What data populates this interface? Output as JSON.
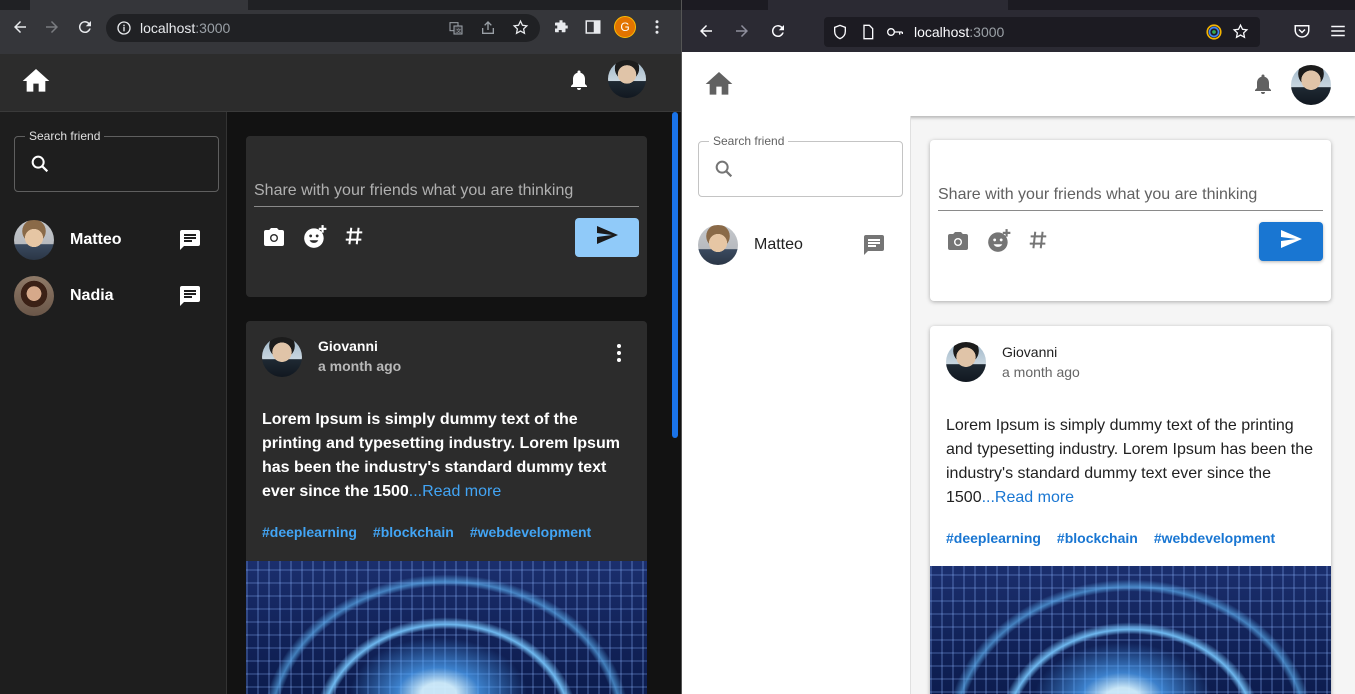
{
  "left_browser": {
    "url_host": "localhost",
    "url_port": ":3000",
    "profile_initial": "G"
  },
  "right_browser": {
    "url_host": "localhost",
    "url_port": ":3000"
  },
  "app": {
    "search_label": "Search friend",
    "friends_left": [
      {
        "name": "Matteo"
      },
      {
        "name": "Nadia"
      }
    ],
    "friends_right": [
      {
        "name": "Matteo"
      }
    ],
    "share_placeholder": "Share with your friends what you are thinking",
    "post": {
      "author": "Giovanni",
      "time": "a month ago",
      "text": "Lorem Ipsum is simply dummy text of the printing and typesetting industry. Lorem Ipsum has been the industry's standard dummy text ever since the 1500",
      "read_more": "...Read more",
      "tags": [
        "#deeplearning",
        "#blockchain",
        "#webdevelopment"
      ]
    }
  },
  "colors": {
    "accent": "#1976d2",
    "send_dark": "#90caf9",
    "dark_surface": "#2c2c2c",
    "dark_bg": "#121212"
  }
}
